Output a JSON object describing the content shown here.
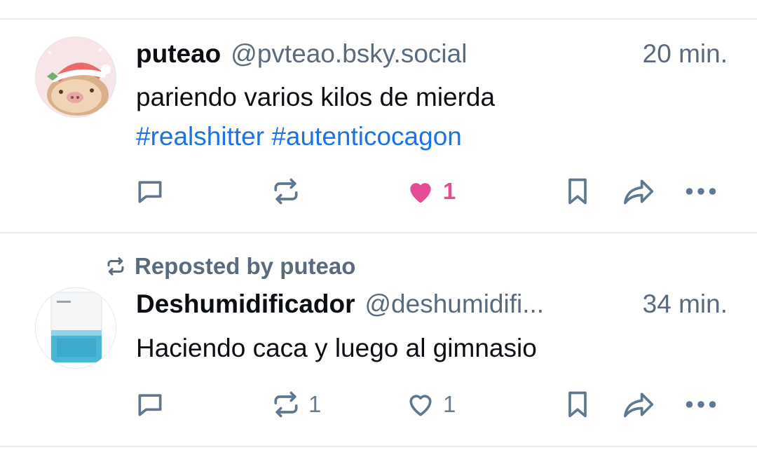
{
  "posts": [
    {
      "author": "puteao",
      "handle": "@pvteao.bsky.social",
      "time": "20 min.",
      "line1": "pariendo varios kilos de mierda",
      "tags": [
        "#realshitter",
        "#autenticocagon"
      ],
      "actions": {
        "reply_count": "",
        "repost_count": "",
        "like_count": "1",
        "liked": true
      },
      "avatar_icon": "pig-with-santa-hat-avatar"
    },
    {
      "reposted_by": "Reposted by puteao",
      "author": "Deshumidificador",
      "handle": "@deshumidifi...",
      "time": "34 min.",
      "line1": "Haciendo caca y luego al gimnasio",
      "actions": {
        "reply_count": "",
        "repost_count": "1",
        "like_count": "1",
        "liked": false
      },
      "avatar_icon": "dehumidifier-avatar"
    }
  ],
  "colors": {
    "accent_link": "#1a73e8",
    "like_pink": "#e64b96",
    "muted": "#5b6b7e",
    "icon": "#5f7891"
  },
  "icons": [
    "reply-icon",
    "repost-icon",
    "like-icon",
    "bookmark-icon",
    "share-icon",
    "more-icon"
  ]
}
